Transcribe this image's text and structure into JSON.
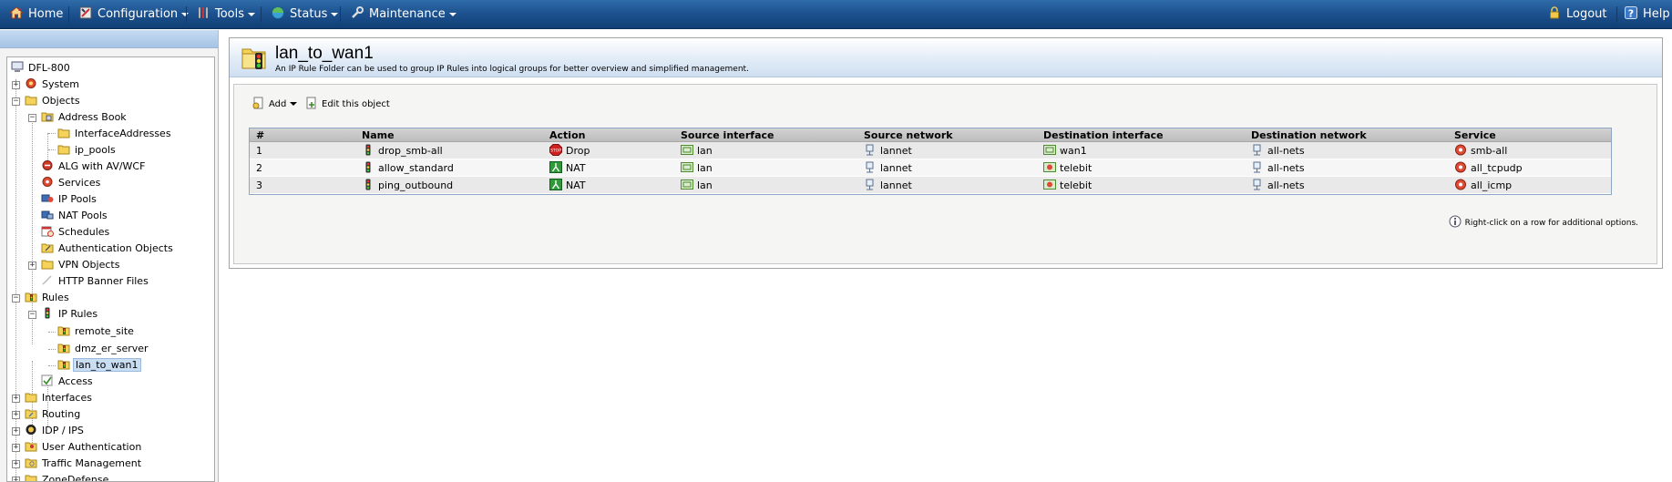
{
  "topbar": {
    "home": "Home",
    "configuration": "Configuration",
    "tools": "Tools",
    "status": "Status",
    "maintenance": "Maintenance",
    "logout": "Logout",
    "help": "Help"
  },
  "tree": {
    "root": "DFL-800",
    "system": "System",
    "objects": "Objects",
    "address_book": "Address Book",
    "interface_addresses": "InterfaceAddresses",
    "ip_pools_folder": "ip_pools",
    "alg": "ALG with AV/WCF",
    "services": "Services",
    "ip_pools": "IP Pools",
    "nat_pools": "NAT Pools",
    "schedules": "Schedules",
    "auth_objects": "Authentication Objects",
    "vpn_objects": "VPN Objects",
    "http_banner": "HTTP Banner Files",
    "rules": "Rules",
    "ip_rules": "IP Rules",
    "remote_site": "remote_site",
    "dmz_er_server": "dmz_er_server",
    "lan_to_wan1": "lan_to_wan1",
    "access": "Access",
    "interfaces": "Interfaces",
    "routing": "Routing",
    "idp_ips": "IDP / IPS",
    "user_auth": "User Authentication",
    "traffic_mgmt": "Traffic Management",
    "zone_defense": "ZoneDefense"
  },
  "main": {
    "title": "lan_to_wan1",
    "description": "An IP Rule Folder can be used to group IP Rules into logical groups for better overview and simplified management.",
    "add_label": "Add",
    "edit_label": "Edit this object",
    "hint": "Right-click on a row for additional options."
  },
  "grid": {
    "columns": [
      "#",
      "Name",
      "Action",
      "Source interface",
      "Source network",
      "Destination interface",
      "Destination network",
      "Service"
    ],
    "rows": [
      [
        "1",
        "drop_smb-all",
        "Drop",
        "lan",
        "lannet",
        "wan1",
        "all-nets",
        "smb-all"
      ],
      [
        "2",
        "allow_standard",
        "NAT",
        "lan",
        "lannet",
        "telebit",
        "all-nets",
        "all_tcpudp"
      ],
      [
        "3",
        "ping_outbound",
        "NAT",
        "lan",
        "lannet",
        "telebit",
        "all-nets",
        "all_icmp"
      ]
    ]
  },
  "colors": {
    "topbar": "#1d5391",
    "drop": "#d21f1f",
    "nat": "#2e9a3a",
    "selection": "#c9ddf3"
  }
}
